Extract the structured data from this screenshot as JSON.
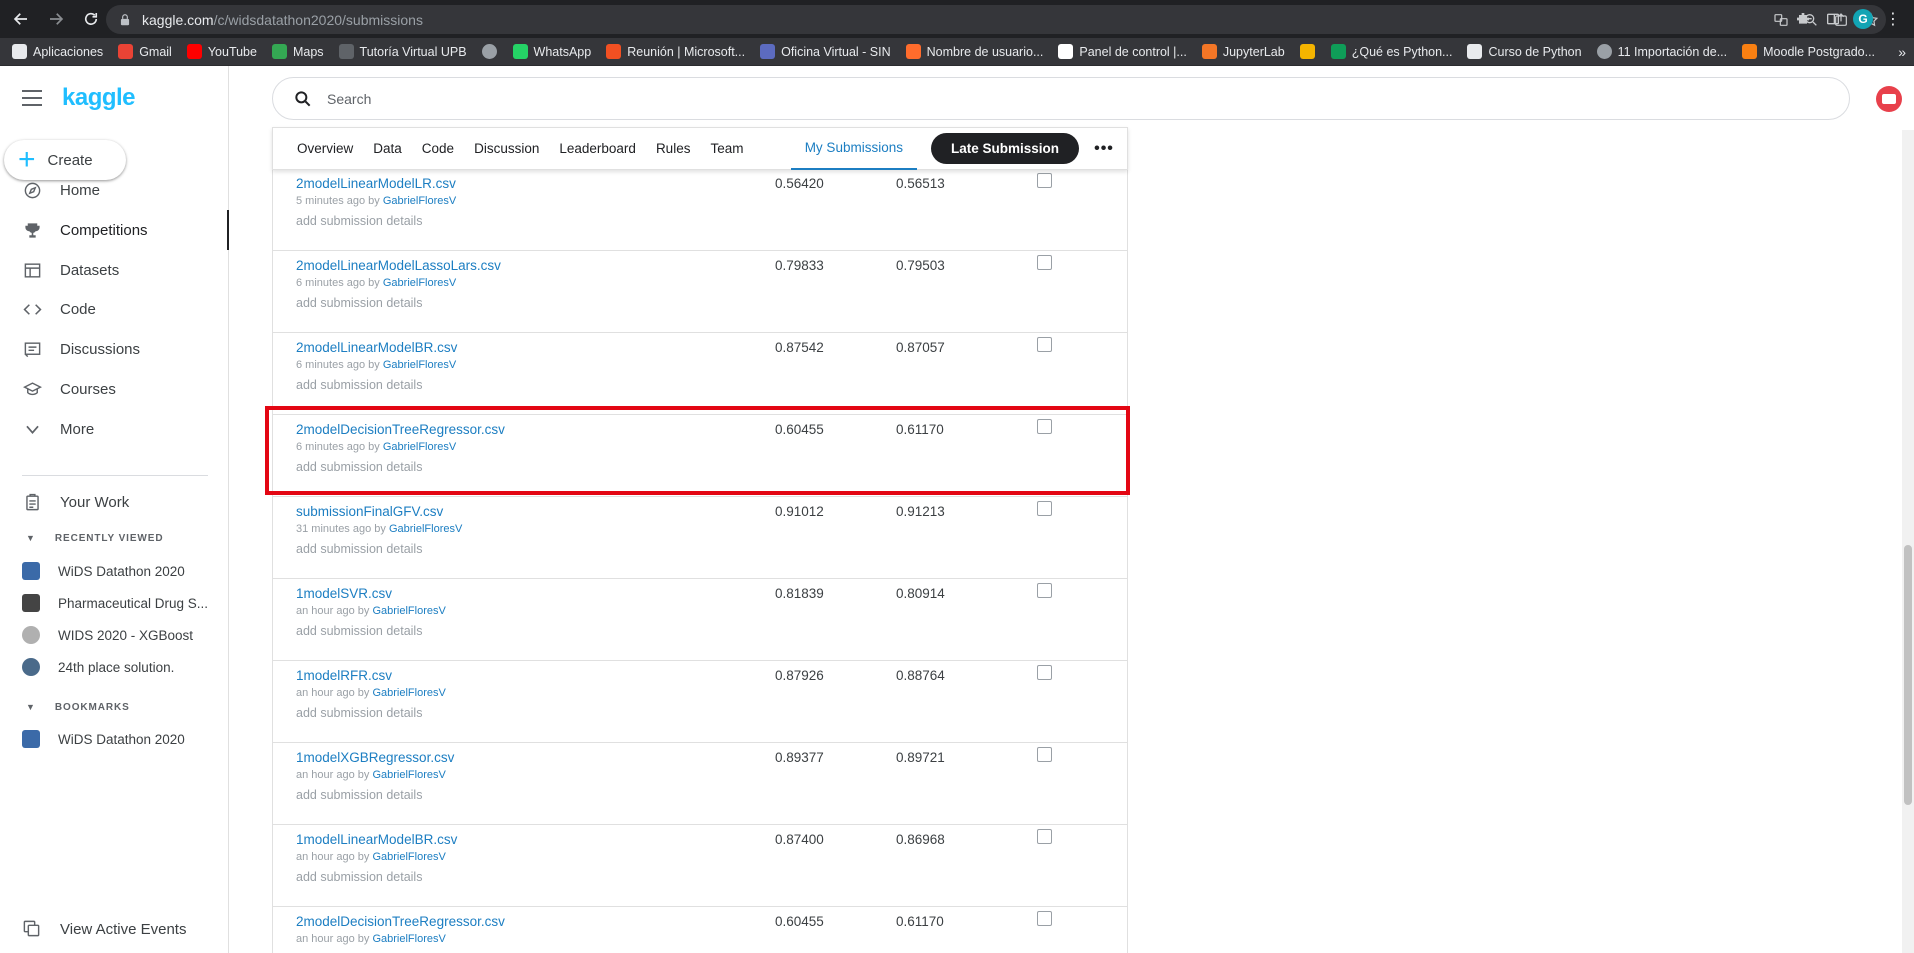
{
  "browser": {
    "url_host": "kaggle.com",
    "url_path": "/c/widsdatathon2020/submissions",
    "profile_initial": "G",
    "bookmarks": [
      {
        "label": "Aplicaciones",
        "icon": "apps-grid-icon",
        "color": "#e8eaed"
      },
      {
        "label": "Gmail",
        "icon": "gmail-icon",
        "color": "#ea4335"
      },
      {
        "label": "YouTube",
        "icon": "youtube-icon",
        "color": "#ff0000"
      },
      {
        "label": "Maps",
        "icon": "maps-icon",
        "color": "#34a853"
      },
      {
        "label": "Tutoría Virtual UPB",
        "icon": "person-icon",
        "color": "#5f6368"
      },
      {
        "label": "",
        "icon": "globe-icon",
        "color": "#9aa0a6"
      },
      {
        "label": "WhatsApp",
        "icon": "whatsapp-icon",
        "color": "#25d366"
      },
      {
        "label": "Reunión | Microsoft...",
        "icon": "microsoft-icon",
        "color": "#f25022"
      },
      {
        "label": "Oficina Virtual - SIN",
        "icon": "building-icon",
        "color": "#5c6bc0"
      },
      {
        "label": "Nombre de usuario...",
        "icon": "cpanel-icon",
        "color": "#ff6c2c"
      },
      {
        "label": "Panel de control |...",
        "icon": "wix-icon",
        "color": "#ffffff"
      },
      {
        "label": "JupyterLab",
        "icon": "jupyter-icon",
        "color": "#f37626"
      },
      {
        "label": "",
        "icon": "image-icon",
        "color": "#f4b400"
      },
      {
        "label": "¿Qué es Python...",
        "icon": "file-icon",
        "color": "#0f9d58"
      },
      {
        "label": "Curso de Python",
        "icon": "udemy-icon",
        "color": "#e8eaed"
      },
      {
        "label": "11 Importación de...",
        "icon": "globe-icon",
        "color": "#9aa0a6"
      },
      {
        "label": "Moodle Postgrado...",
        "icon": "moodle-icon",
        "color": "#f98012"
      }
    ]
  },
  "sidebar": {
    "logo": "kaggle",
    "create_label": "Create",
    "nav": [
      {
        "label": "Home",
        "icon": "compass-icon"
      },
      {
        "label": "Competitions",
        "icon": "trophy-icon"
      },
      {
        "label": "Datasets",
        "icon": "table-icon"
      },
      {
        "label": "Code",
        "icon": "code-icon"
      },
      {
        "label": "Discussions",
        "icon": "discussion-icon"
      },
      {
        "label": "Courses",
        "icon": "school-icon"
      },
      {
        "label": "More",
        "icon": "chevron-down-icon"
      }
    ],
    "your_work": "Your Work",
    "recently_viewed_header": "RECENTLY VIEWED",
    "recently_viewed": [
      {
        "label": "WiDS Datathon 2020",
        "color": "#3b6aa8"
      },
      {
        "label": "Pharmaceutical Drug S...",
        "color": "#444444"
      },
      {
        "label": "WIDS 2020 - XGBoost",
        "color": "#b0b0b0"
      },
      {
        "label": "24th place solution.",
        "color": "#4a6a8a"
      }
    ],
    "bookmarks_header": "BOOKMARKS",
    "bookmarks": [
      {
        "label": "WiDS Datathon 2020",
        "color": "#3b6aa8"
      }
    ],
    "view_active_events": "View Active Events"
  },
  "search": {
    "placeholder": "Search"
  },
  "tabs": {
    "items": [
      "Overview",
      "Data",
      "Code",
      "Discussion",
      "Leaderboard",
      "Rules",
      "Team"
    ],
    "active": "My Submissions",
    "late_submission": "Late Submission",
    "more": "•••"
  },
  "submissions": [
    {
      "file": "2modelLinearModelLR.csv",
      "time": "5 minutes ago",
      "by": "by",
      "user": "GabrielFloresV",
      "details": "add submission details",
      "private": "0.56420",
      "public": "0.56513"
    },
    {
      "file": "2modelLinearModelLassoLars.csv",
      "time": "6 minutes ago",
      "by": "by",
      "user": "GabrielFloresV",
      "details": "add submission details",
      "private": "0.79833",
      "public": "0.79503"
    },
    {
      "file": "2modelLinearModelBR.csv",
      "time": "6 minutes ago",
      "by": "by",
      "user": "GabrielFloresV",
      "details": "add submission details",
      "private": "0.87542",
      "public": "0.87057"
    },
    {
      "file": "2modelDecisionTreeRegressor.csv",
      "time": "6 minutes ago",
      "by": "by",
      "user": "GabrielFloresV",
      "details": "add submission details",
      "private": "0.60455",
      "public": "0.61170"
    },
    {
      "file": "submissionFinalGFV.csv",
      "time": "31 minutes ago",
      "by": "by",
      "user": "GabrielFloresV",
      "details": "add submission details",
      "private": "0.91012",
      "public": "0.91213"
    },
    {
      "file": "1modelSVR.csv",
      "time": "an hour ago",
      "by": "by",
      "user": "GabrielFloresV",
      "details": "add submission details",
      "private": "0.81839",
      "public": "0.80914"
    },
    {
      "file": "1modelRFR.csv",
      "time": "an hour ago",
      "by": "by",
      "user": "GabrielFloresV",
      "details": "add submission details",
      "private": "0.87926",
      "public": "0.88764"
    },
    {
      "file": "1modelXGBRegressor.csv",
      "time": "an hour ago",
      "by": "by",
      "user": "GabrielFloresV",
      "details": "add submission details",
      "private": "0.89377",
      "public": "0.89721"
    },
    {
      "file": "1modelLinearModelBR.csv",
      "time": "an hour ago",
      "by": "by",
      "user": "GabrielFloresV",
      "details": "add submission details",
      "private": "0.87400",
      "public": "0.86968"
    },
    {
      "file": "2modelDecisionTreeRegressor.csv",
      "time": "an hour ago",
      "by": "by",
      "user": "GabrielFloresV",
      "details": "",
      "private": "0.60455",
      "public": "0.61170"
    }
  ],
  "colors": {
    "kaggle_blue": "#20beff",
    "link_blue": "#1c7ec2",
    "highlight_red": "#e30613"
  }
}
